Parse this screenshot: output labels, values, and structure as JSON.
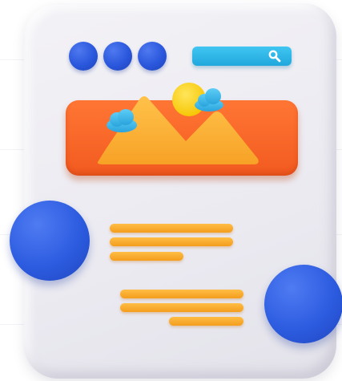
{
  "illustration": {
    "subject": "web-page-illustration",
    "colors": {
      "card": "#efeef3",
      "dot_blue": "#2a57dc",
      "search_bar": "#2bb6e8",
      "banner": "#f56225",
      "mountain": "#ffb233",
      "sun": "#ffd21f",
      "cloud": "#3fb8ee",
      "text_line": "#f7a928"
    },
    "icons": [
      "search-icon",
      "image-icon"
    ],
    "window_dots": [
      {
        "name": "dot-1"
      },
      {
        "name": "dot-2"
      },
      {
        "name": "dot-3"
      }
    ],
    "text_block_1_lines": 3,
    "text_block_2_lines": 3
  }
}
